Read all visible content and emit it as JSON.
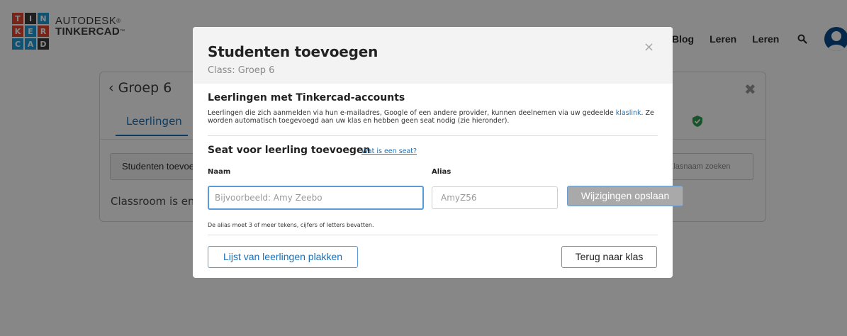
{
  "app": {
    "logo_letters": [
      "T",
      "I",
      "N",
      "K",
      "E",
      "R",
      "C",
      "A",
      "D"
    ],
    "logo_colors": [
      "#e2442f",
      "#3c3c3c",
      "#1f9bd7",
      "#e2442f",
      "#1f9bd7",
      "#e2442f",
      "#1f9bd7",
      "#1f9bd7",
      "#3c3c3c"
    ],
    "brand_top": "AUTODESK",
    "brand_registered": "®",
    "brand_bottom": "TINKERCAD",
    "brand_trademark": "™"
  },
  "topnav": {
    "items": [
      "Blog",
      "Leren",
      "Leren"
    ],
    "search_icon": "search-icon",
    "avatar_icon": "user-avatar-icon"
  },
  "background": {
    "back_chevron": "‹",
    "group_name": "Groep 6",
    "close_glyph": "✖",
    "tab_label": "Leerlingen",
    "shield_icon": "shield-check-icon",
    "shield_color": "#2e9e4f",
    "add_students_label": "Studenten toevoegen",
    "search_placeholder": "Klasnaam zoeken",
    "empty_text": "Classroom is empty"
  },
  "modal": {
    "title": "Studenten toevoegen",
    "subtitle": "Class: Groep 6",
    "close_glyph": "×",
    "accounts_title": "Leerlingen met Tinkercad-accounts",
    "accounts_desc_before": "Leerlingen die zich aanmelden via hun e-mailadres, Google of een andere provider, kunnen deelnemen via uw gedeelde ",
    "accounts_desc_link": "klaslink",
    "accounts_desc_after": ". Ze worden automatisch toegevoegd aan uw klas en hebben geen seat nodig (zie hieronder).",
    "seat_title": "Seat voor leerling toevoegen",
    "seat_link": "Wat is een seat?",
    "name_label": "Naam",
    "name_placeholder": "Bijvoorbeeld: Amy Zeebo",
    "name_value": "",
    "alias_label": "Alias",
    "alias_placeholder": "AmyZ56",
    "alias_value": "",
    "save_label": "Wijzigingen opslaan",
    "hint": "De alias moet 3 of meer tekens, cijfers of letters bevatten.",
    "paste_label": "Lijst van leerlingen plakken",
    "back_label": "Terug naar klas"
  },
  "colors": {
    "accent": "#1b6fb3",
    "overlay": "rgba(0,0,0,0.47)",
    "disabled_button": "#a9a9a9"
  }
}
